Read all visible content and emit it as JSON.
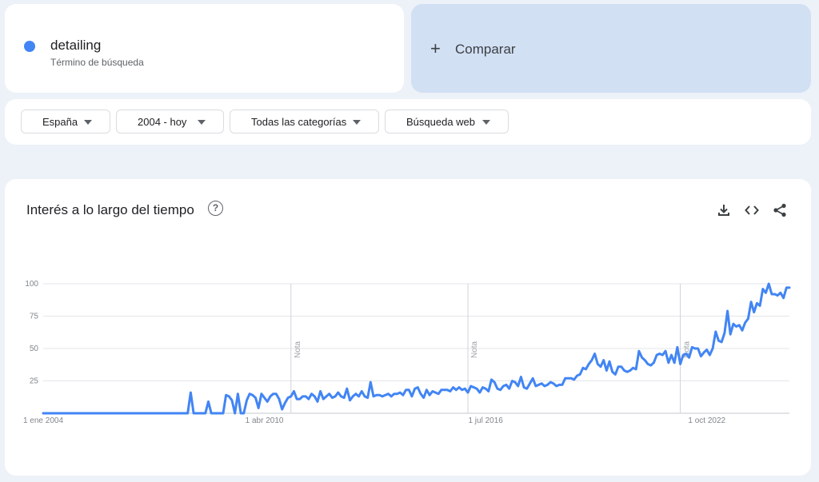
{
  "term": {
    "name": "detailing",
    "subtitle": "Término de búsqueda",
    "color": "#4285f4"
  },
  "compare": {
    "plus": "+",
    "label": "Comparar"
  },
  "filters": [
    {
      "label": "España"
    },
    {
      "label": "2004 - hoy"
    },
    {
      "label": "Todas las categorías"
    },
    {
      "label": "Búsqueda web"
    }
  ],
  "panel": {
    "title": "Interés a lo largo del tiempo",
    "help_icon": "help-circle-icon",
    "tools": [
      "download-icon",
      "embed-code-icon",
      "share-icon"
    ]
  },
  "chart_data": {
    "type": "line",
    "title": "Interés a lo largo del tiempo",
    "xlabel": "",
    "ylabel": "",
    "ylim": [
      0,
      100
    ],
    "yticks": [
      25,
      50,
      75,
      100
    ],
    "xticks": [
      {
        "label": "1 ene 2004",
        "date": "2004-01"
      },
      {
        "label": "1 abr 2010",
        "date": "2010-04"
      },
      {
        "label": "1 jul 2016",
        "date": "2016-07"
      },
      {
        "label": "1 oct 2022",
        "date": "2022-10"
      }
    ],
    "notes": [
      {
        "label": "Nota",
        "date": "2011-01"
      },
      {
        "label": "Nota",
        "date": "2016-01"
      },
      {
        "label": "Nota",
        "date": "2022-01"
      }
    ],
    "grid": true,
    "color": "#4285f4",
    "series": [
      {
        "name": "detailing",
        "points": [
          [
            "2004-01",
            0
          ],
          [
            "2007-12",
            0
          ],
          [
            "2008-02",
            0
          ],
          [
            "2008-03",
            16
          ],
          [
            "2008-04",
            0
          ],
          [
            "2008-08",
            0
          ],
          [
            "2008-09",
            9
          ],
          [
            "2008-10",
            0
          ],
          [
            "2009-02",
            0
          ],
          [
            "2009-03",
            14
          ],
          [
            "2009-04",
            13
          ],
          [
            "2009-05",
            10
          ],
          [
            "2009-06",
            0
          ],
          [
            "2009-07",
            15
          ],
          [
            "2009-08",
            0
          ],
          [
            "2009-09",
            0
          ],
          [
            "2009-10",
            10
          ],
          [
            "2009-11",
            15
          ],
          [
            "2009-12",
            14
          ],
          [
            "2010-01",
            12
          ],
          [
            "2010-02",
            4
          ],
          [
            "2010-03",
            15
          ],
          [
            "2010-04",
            12
          ],
          [
            "2010-05",
            9
          ],
          [
            "2010-06",
            13
          ],
          [
            "2010-07",
            15
          ],
          [
            "2010-08",
            15
          ],
          [
            "2010-09",
            11
          ],
          [
            "2010-10",
            3
          ],
          [
            "2010-11",
            8
          ],
          [
            "2010-12",
            12
          ],
          [
            "2011-01",
            13
          ],
          [
            "2011-02",
            17
          ],
          [
            "2011-03",
            11
          ],
          [
            "2011-04",
            11
          ],
          [
            "2011-05",
            13
          ],
          [
            "2011-06",
            13
          ],
          [
            "2011-07",
            11
          ],
          [
            "2011-08",
            15
          ],
          [
            "2011-09",
            13
          ],
          [
            "2011-10",
            9
          ],
          [
            "2011-11",
            17
          ],
          [
            "2011-12",
            11
          ],
          [
            "2012-01",
            13
          ],
          [
            "2012-02",
            15
          ],
          [
            "2012-03",
            12
          ],
          [
            "2012-04",
            13
          ],
          [
            "2012-05",
            16
          ],
          [
            "2012-06",
            13
          ],
          [
            "2012-07",
            12
          ],
          [
            "2012-08",
            19
          ],
          [
            "2012-09",
            10
          ],
          [
            "2012-10",
            13
          ],
          [
            "2012-11",
            15
          ],
          [
            "2012-12",
            13
          ],
          [
            "2013-01",
            17
          ],
          [
            "2013-02",
            13
          ],
          [
            "2013-03",
            12
          ],
          [
            "2013-04",
            24
          ],
          [
            "2013-05",
            13
          ],
          [
            "2013-06",
            14
          ],
          [
            "2013-07",
            14
          ],
          [
            "2013-08",
            13
          ],
          [
            "2013-09",
            14
          ],
          [
            "2013-10",
            15
          ],
          [
            "2013-11",
            13
          ],
          [
            "2013-12",
            15
          ],
          [
            "2014-01",
            15
          ],
          [
            "2014-02",
            16
          ],
          [
            "2014-03",
            14
          ],
          [
            "2014-04",
            18
          ],
          [
            "2014-05",
            18
          ],
          [
            "2014-06",
            13
          ],
          [
            "2014-07",
            19
          ],
          [
            "2014-08",
            20
          ],
          [
            "2014-09",
            15
          ],
          [
            "2014-10",
            12
          ],
          [
            "2014-11",
            18
          ],
          [
            "2014-12",
            14
          ],
          [
            "2015-01",
            17
          ],
          [
            "2015-02",
            16
          ],
          [
            "2015-03",
            15
          ],
          [
            "2015-04",
            18
          ],
          [
            "2015-05",
            18
          ],
          [
            "2015-06",
            18
          ],
          [
            "2015-07",
            17
          ],
          [
            "2015-08",
            20
          ],
          [
            "2015-09",
            18
          ],
          [
            "2015-10",
            20
          ],
          [
            "2015-11",
            18
          ],
          [
            "2015-12",
            19
          ],
          [
            "2016-01",
            16
          ],
          [
            "2016-02",
            21
          ],
          [
            "2016-03",
            20
          ],
          [
            "2016-04",
            19
          ],
          [
            "2016-05",
            16
          ],
          [
            "2016-06",
            20
          ],
          [
            "2016-07",
            19
          ],
          [
            "2016-08",
            17
          ],
          [
            "2016-09",
            26
          ],
          [
            "2016-10",
            24
          ],
          [
            "2016-11",
            19
          ],
          [
            "2016-12",
            18
          ],
          [
            "2017-01",
            21
          ],
          [
            "2017-02",
            22
          ],
          [
            "2017-03",
            19
          ],
          [
            "2017-04",
            25
          ],
          [
            "2017-05",
            24
          ],
          [
            "2017-06",
            21
          ],
          [
            "2017-07",
            28
          ],
          [
            "2017-08",
            20
          ],
          [
            "2017-09",
            19
          ],
          [
            "2017-10",
            23
          ],
          [
            "2017-11",
            27
          ],
          [
            "2017-12",
            21
          ],
          [
            "2018-01",
            22
          ],
          [
            "2018-02",
            23
          ],
          [
            "2018-03",
            21
          ],
          [
            "2018-04",
            22
          ],
          [
            "2018-05",
            24
          ],
          [
            "2018-06",
            23
          ],
          [
            "2018-07",
            21
          ],
          [
            "2018-08",
            22
          ],
          [
            "2018-09",
            22
          ],
          [
            "2018-10",
            27
          ],
          [
            "2018-11",
            27
          ],
          [
            "2018-12",
            27
          ],
          [
            "2019-01",
            26
          ],
          [
            "2019-02",
            29
          ],
          [
            "2019-03",
            30
          ],
          [
            "2019-04",
            35
          ],
          [
            "2019-05",
            34
          ],
          [
            "2019-06",
            38
          ],
          [
            "2019-07",
            41
          ],
          [
            "2019-08",
            46
          ],
          [
            "2019-09",
            38
          ],
          [
            "2019-10",
            36
          ],
          [
            "2019-11",
            41
          ],
          [
            "2019-12",
            33
          ],
          [
            "2020-01",
            40
          ],
          [
            "2020-02",
            32
          ],
          [
            "2020-03",
            30
          ],
          [
            "2020-04",
            36
          ],
          [
            "2020-05",
            36
          ],
          [
            "2020-06",
            33
          ],
          [
            "2020-07",
            32
          ],
          [
            "2020-08",
            33
          ],
          [
            "2020-09",
            35
          ],
          [
            "2020-10",
            34
          ],
          [
            "2020-11",
            48
          ],
          [
            "2020-12",
            43
          ],
          [
            "2021-01",
            41
          ],
          [
            "2021-02",
            38
          ],
          [
            "2021-03",
            37
          ],
          [
            "2021-04",
            39
          ],
          [
            "2021-05",
            45
          ],
          [
            "2021-06",
            46
          ],
          [
            "2021-07",
            45
          ],
          [
            "2021-08",
            48
          ],
          [
            "2021-09",
            39
          ],
          [
            "2021-10",
            45
          ],
          [
            "2021-11",
            39
          ],
          [
            "2021-12",
            51
          ],
          [
            "2022-01",
            38
          ],
          [
            "2022-02",
            45
          ],
          [
            "2022-03",
            46
          ],
          [
            "2022-04",
            43
          ],
          [
            "2022-05",
            51
          ],
          [
            "2022-06",
            50
          ],
          [
            "2022-07",
            50
          ],
          [
            "2022-08",
            44
          ],
          [
            "2022-09",
            47
          ],
          [
            "2022-10",
            49
          ],
          [
            "2022-11",
            45
          ],
          [
            "2022-12",
            50
          ],
          [
            "2023-01",
            63
          ],
          [
            "2023-02",
            56
          ],
          [
            "2023-03",
            55
          ],
          [
            "2023-04",
            62
          ],
          [
            "2023-05",
            79
          ],
          [
            "2023-06",
            61
          ],
          [
            "2023-07",
            69
          ],
          [
            "2023-08",
            67
          ],
          [
            "2023-09",
            68
          ],
          [
            "2023-10",
            64
          ],
          [
            "2023-11",
            70
          ],
          [
            "2023-12",
            73
          ],
          [
            "2024-01",
            86
          ],
          [
            "2024-02",
            78
          ],
          [
            "2024-03",
            85
          ],
          [
            "2024-04",
            83
          ],
          [
            "2024-05",
            96
          ],
          [
            "2024-06",
            93
          ],
          [
            "2024-07",
            100
          ],
          [
            "2024-08",
            92
          ],
          [
            "2024-09",
            92
          ],
          [
            "2024-10",
            91
          ],
          [
            "2024-11",
            93
          ],
          [
            "2024-12",
            89
          ],
          [
            "2025-01",
            97
          ],
          [
            "2025-02",
            97
          ]
        ]
      }
    ]
  }
}
